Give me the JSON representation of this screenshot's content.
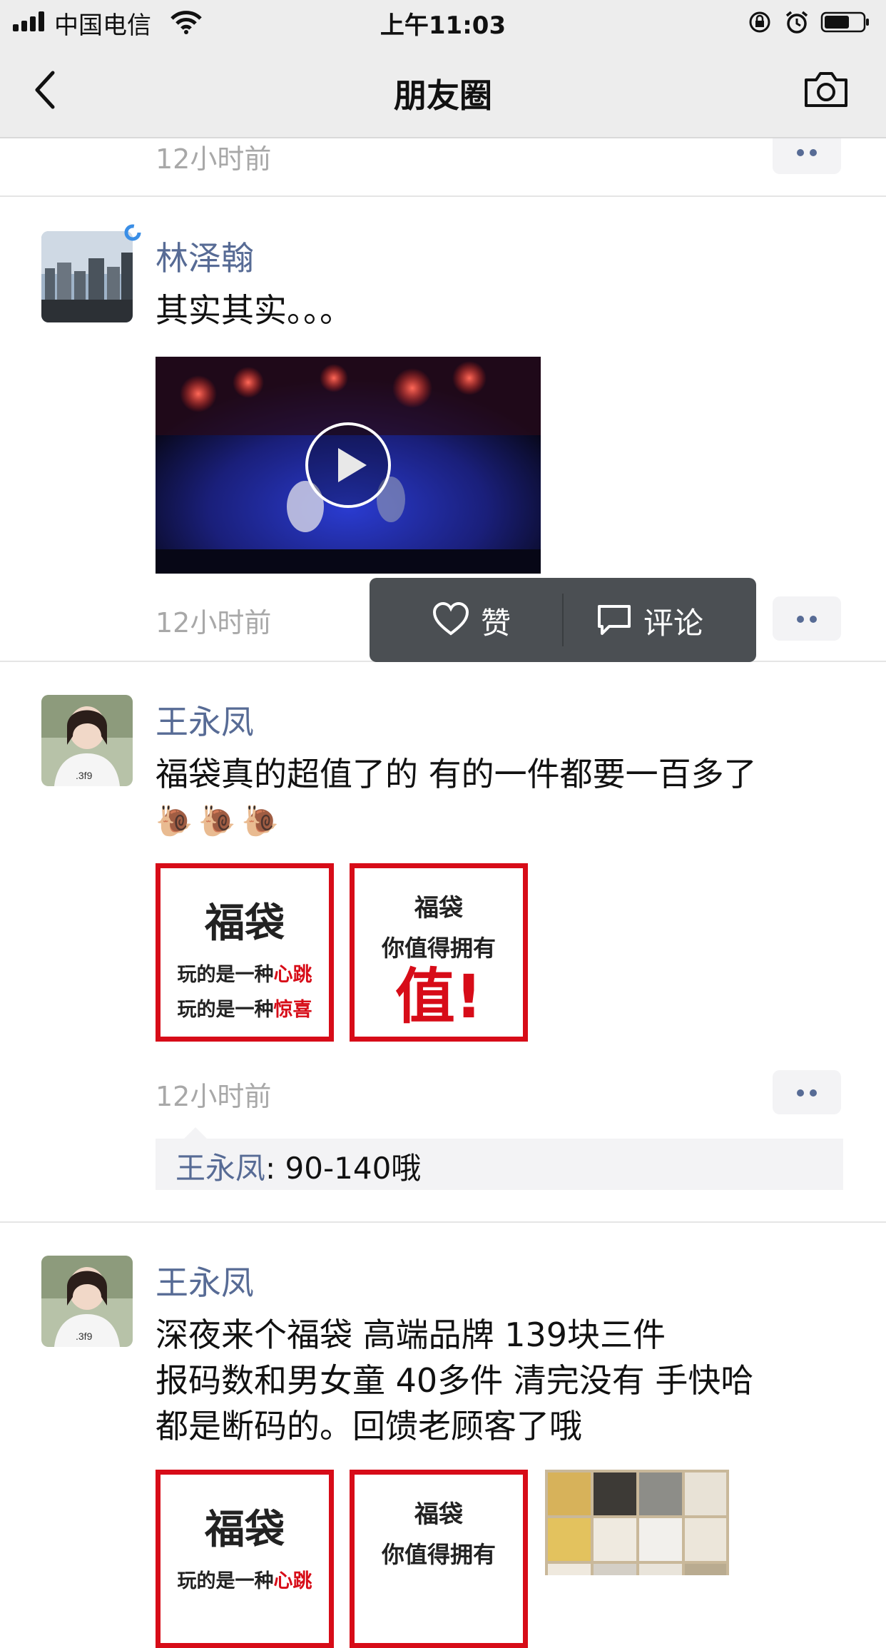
{
  "status_bar": {
    "carrier": "中国电信",
    "time": "上午11:03"
  },
  "nav": {
    "title": "朋友圈"
  },
  "colors": {
    "link_blue": "#576b95",
    "fudai_red": "#d70c18",
    "nav_bg": "#ededed",
    "popup_bg": "#4b4f53"
  },
  "feed": {
    "prev_post": {
      "time": "12小时前"
    },
    "posts": [
      {
        "author": "林泽翰",
        "text": "其实其实。。。",
        "media": "video",
        "time": "12小时前"
      },
      {
        "author": "王永凤",
        "text": "福袋真的超值了的 有的一件都要一百多了",
        "emoji": "🐌🐌🐌",
        "time": "12小时前",
        "comment": {
          "name": "王永凤",
          "sep": ": ",
          "text": "90-140哦"
        }
      },
      {
        "author": "王永凤",
        "lines": [
          "深夜来个福袋 高端品牌 139块三件",
          "报码数和男女童 40多件 清完没有  手快哈",
          "都是断码的。回馈老顾客了哦"
        ]
      }
    ]
  },
  "fudai_card_a": {
    "title": "福袋",
    "line1_prefix": "玩的是一种",
    "line1_red": "心跳",
    "line2_prefix": "玩的是一种",
    "line2_red": "惊喜"
  },
  "fudai_card_b": {
    "title": "福袋",
    "line1": "你值得拥有",
    "big": "值!"
  },
  "action_popup": {
    "like": "赞",
    "comment": "评论"
  }
}
